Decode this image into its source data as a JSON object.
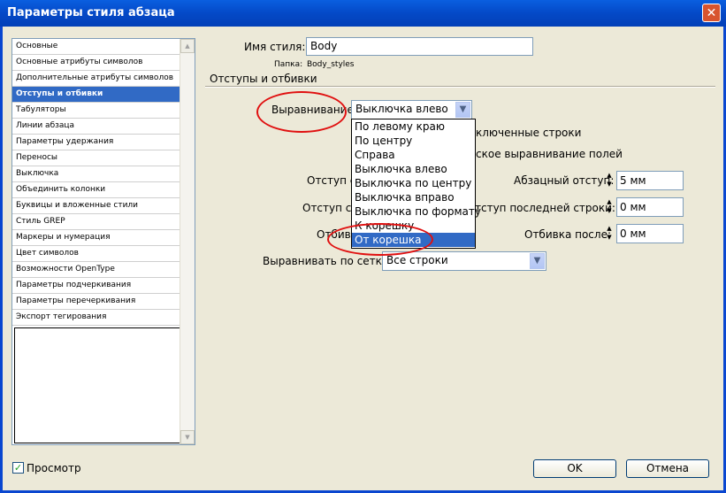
{
  "window": {
    "title": "Параметры стиля абзаца",
    "close_glyph": "✕"
  },
  "categories": [
    "Основные",
    "Основные атрибуты символов",
    "Дополнительные атрибуты символов",
    "Отступы и отбивки",
    "Табуляторы",
    "Линии абзаца",
    "Параметры удержания",
    "Переносы",
    "Выключка",
    "Объединить колонки",
    "Буквицы и вложенные стили",
    "Стиль GREP",
    "Маркеры и нумерация",
    "Цвет символов",
    "Возможности OpenType",
    "Параметры подчеркивания",
    "Параметры перечеркивания",
    "Экспорт тегирования"
  ],
  "selected_category_index": 3,
  "style": {
    "name_label": "Имя стиля:",
    "name_value": "Body",
    "folder_label": "Папка:",
    "folder_value": "Body_styles"
  },
  "section_title": "Отступы и отбивки",
  "alignment": {
    "label": "Выравнивание:",
    "value": "Выключка влево",
    "options": [
      "По левому краю",
      "По центру",
      "Справа",
      "Выключка влево",
      "Выключка по центру",
      "Выключка вправо",
      "Выключка по формату",
      "К корешку",
      "От корешка"
    ],
    "highlighted_index": 8
  },
  "partial_labels": {
    "balance_lines": "ключенные строки",
    "optical_margin": "ское выравнивание полей",
    "indent_left": "Отступ с",
    "indent_right": "Отступ сп",
    "space_before": "Отбивк"
  },
  "fields": {
    "first_indent_label": "Абзацный отступ:",
    "first_indent_value": "5 мм",
    "last_line_indent_label": "тступ последней строки:",
    "last_line_indent_value": "0 мм",
    "space_after_label": "Отбивка после:",
    "space_after_value": "0 мм"
  },
  "grid": {
    "label": "Выравнивать по сетке:",
    "value": "Все строки"
  },
  "preview": {
    "label": "Просмотр",
    "checked": true
  },
  "buttons": {
    "ok": "OK",
    "cancel": "Отмена"
  },
  "colors": {
    "title_bar": "#0a5fe0",
    "selection": "#316ac5",
    "annotation_circle": "#e01010"
  }
}
